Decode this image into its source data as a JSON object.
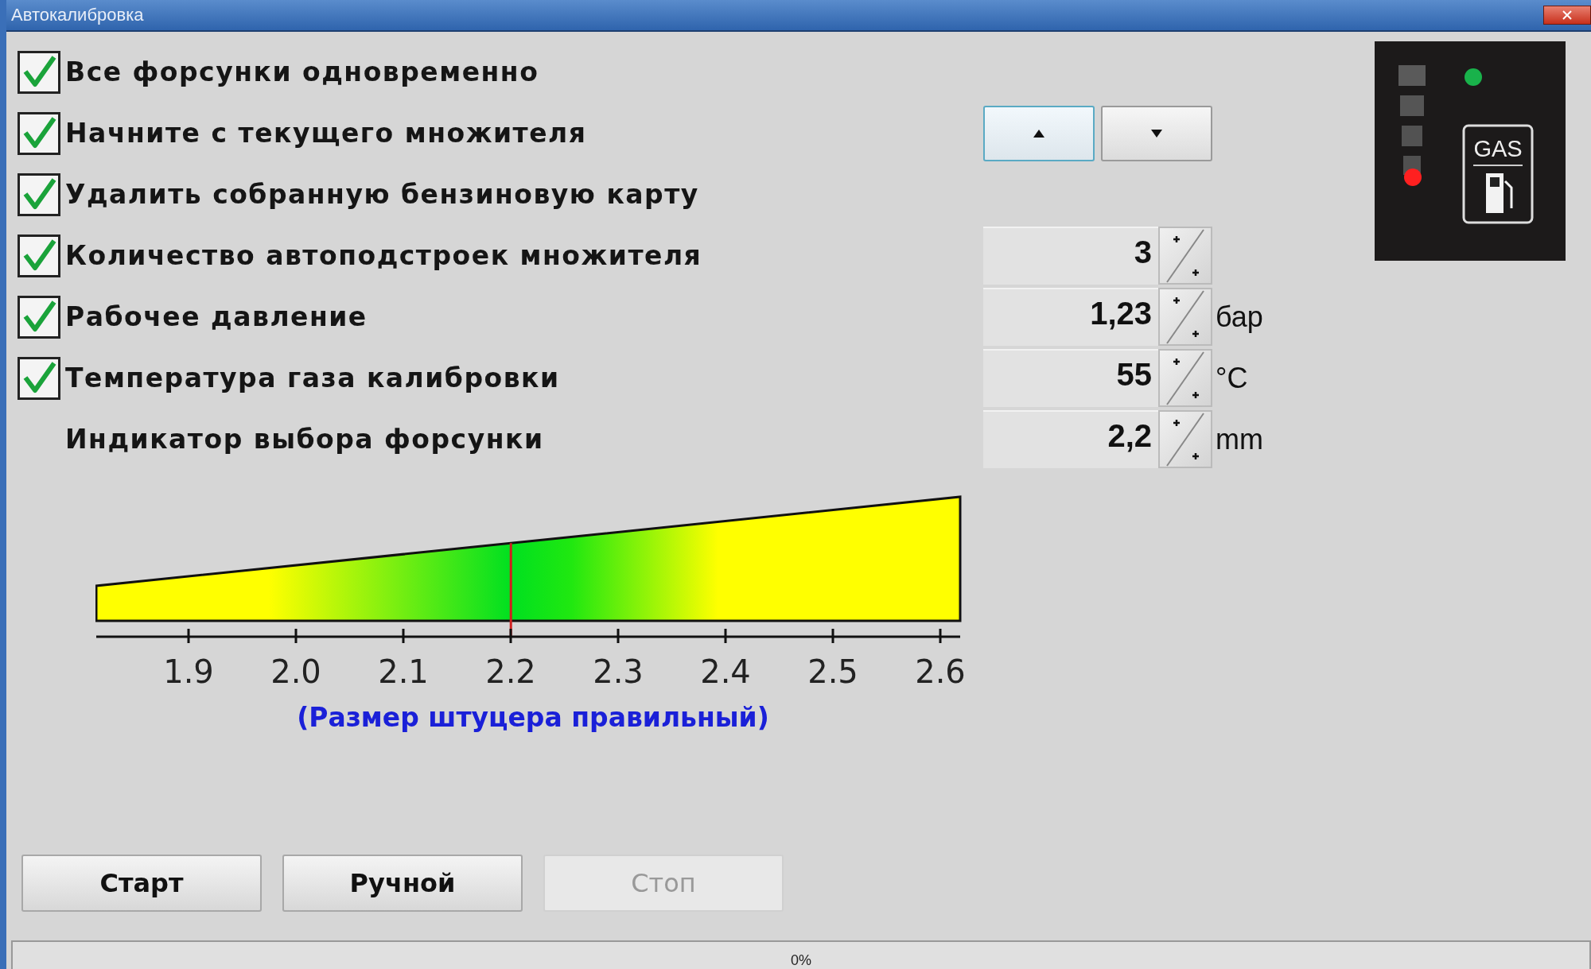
{
  "window": {
    "title": "Автокалибровка"
  },
  "rows": [
    {
      "kind": "checkbox",
      "label": "Все форсунки одновременно",
      "checked": true
    },
    {
      "kind": "checkbox",
      "label": "Начните с текущего множителя",
      "checked": true,
      "control": {
        "kind": "arrows",
        "buttons": [
          {
            "kind": "up",
            "focused": true
          },
          {
            "kind": "down",
            "focused": false
          }
        ]
      }
    },
    {
      "kind": "checkbox",
      "label": "Удалить собранную бензиновую карту",
      "checked": true
    },
    {
      "kind": "checkbox",
      "label": "Количество автоподстроек множителя",
      "checked": true,
      "control": {
        "kind": "spinner",
        "value": "3"
      }
    },
    {
      "kind": "checkbox",
      "label": "Рабочее давление",
      "checked": true,
      "control": {
        "kind": "spinner",
        "value": "1,23",
        "unit": "бар"
      }
    },
    {
      "kind": "checkbox",
      "label": "Температура газа калибровки",
      "checked": true,
      "control": {
        "kind": "spinner",
        "value": "55",
        "unit": "°C"
      }
    },
    {
      "kind": "plain",
      "label": "Индикатор выбора форсунки",
      "control": {
        "kind": "spinner",
        "value": "2,2",
        "unit": "mm"
      }
    }
  ],
  "gas_indicator": {
    "label": "GAS",
    "lamps": [
      {
        "color": "#19b24b"
      },
      {
        "color": "#ff2020"
      }
    ]
  },
  "nozzle_gauge": {
    "ticks": [
      "1.9",
      "2.0",
      "2.1",
      "2.2",
      "2.3",
      "2.4",
      "2.5",
      "2.6"
    ],
    "marker": {
      "level": 0.48
    },
    "message": "(Размер штуцера правильный)"
  },
  "buttons": [
    {
      "label": "Старт",
      "disabled": false
    },
    {
      "label": "Ручной",
      "disabled": false
    },
    {
      "label": "Стоп",
      "disabled": true
    }
  ],
  "progress": {
    "level": 0,
    "label": "0%"
  }
}
